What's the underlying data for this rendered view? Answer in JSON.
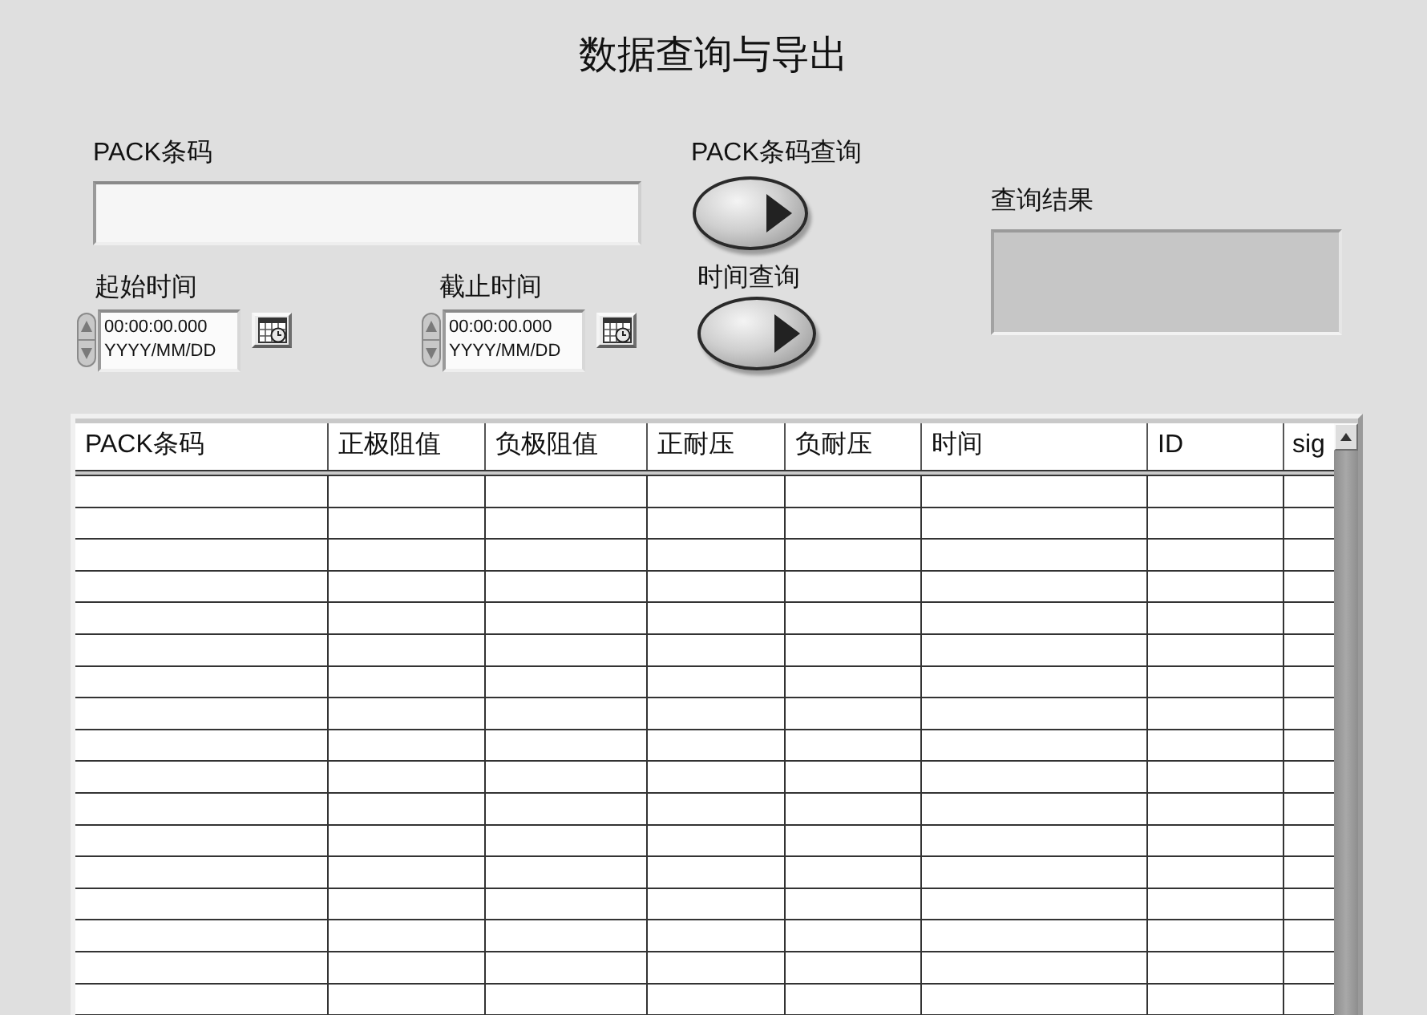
{
  "window": {
    "title": "数据查询与导出"
  },
  "barcode_field": {
    "label": "PACK条码"
  },
  "barcode_query_button": {
    "label": "PACK条码查询"
  },
  "result_display": {
    "label": "查询结果"
  },
  "start_time": {
    "label": "起始时间",
    "time": "00:00:00.000",
    "date": "YYYY/MM/DD"
  },
  "end_time": {
    "label": "截止时间",
    "time": "00:00:00.000",
    "date": "YYYY/MM/DD"
  },
  "time_query_button": {
    "label": "时间查询"
  },
  "table": {
    "columns": [
      "PACK条码",
      "正极阻值",
      "负极阻值",
      "正耐压",
      "负耐压",
      "时间",
      "ID",
      "sig"
    ]
  }
}
